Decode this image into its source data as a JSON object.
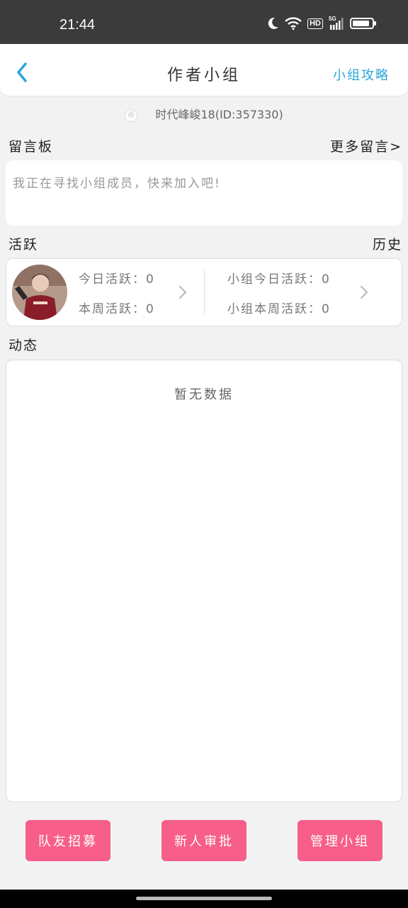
{
  "status_bar": {
    "time": "21:44",
    "hd_label": "HD",
    "signal_label": "5G",
    "icons": [
      "moon-icon",
      "wifi-icon",
      "hd-icon",
      "signal-5g-icon",
      "battery-icon"
    ],
    "battery_level": 0.9
  },
  "header": {
    "back_icon": "chevron-left-icon",
    "title": "作者小组",
    "link_label": "小组攻略"
  },
  "owner": {
    "icon": "badge-icon",
    "icon_text": "㊇",
    "text": "时代峰峻18(ID:357330)"
  },
  "message_board": {
    "title": "留言板",
    "more_label": "更多留言>",
    "content": "我正在寻找小组成员，快来加入吧!"
  },
  "activity": {
    "title": "活跃",
    "history_label": "历史",
    "today": "今日活跃：0",
    "week": "本周活跃：0",
    "group_today": "小组今日活跃：0",
    "group_week": "小组本周活跃：0"
  },
  "feed": {
    "title": "动态",
    "empty_text": "暂无数据"
  },
  "actions": {
    "recruit": "队友招募",
    "approve": "新人审批",
    "manage": "管理小组"
  },
  "colors": {
    "accent_blue": "#2aa6d8",
    "button_pink": "#f75f8a",
    "background": "#f2f2f2",
    "status_bar": "#3b3b3b"
  }
}
